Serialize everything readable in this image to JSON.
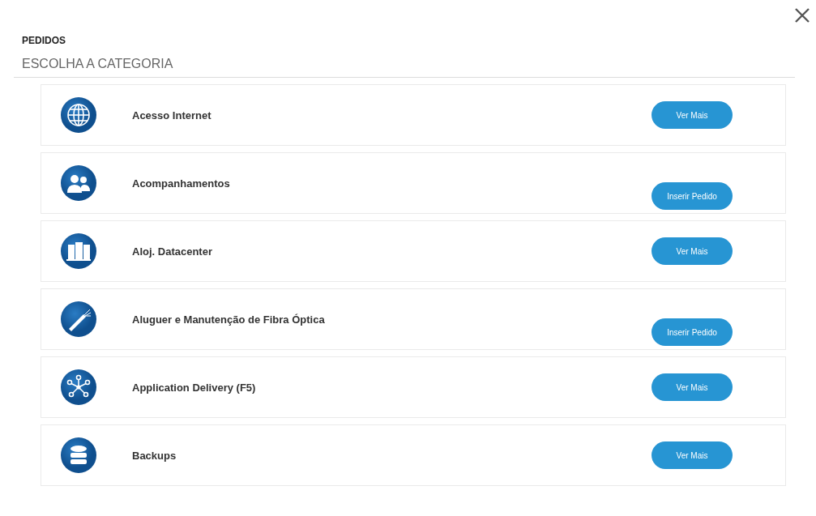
{
  "title": "PEDIDOS",
  "subtitle": "ESCOLHA A CATEGORIA",
  "categories": [
    {
      "name": "Acesso Internet",
      "action": {
        "kind": "more",
        "label": "Ver Mais"
      }
    },
    {
      "name": "Acompanhamentos",
      "action": {
        "kind": "order",
        "label": "Inserir Pedido"
      }
    },
    {
      "name": "Aloj. Datacenter",
      "action": {
        "kind": "more",
        "label": "Ver Mais"
      }
    },
    {
      "name": "Aluguer e Manutenção de Fibra Óptica",
      "action": {
        "kind": "order",
        "label": "Inserir Pedido"
      }
    },
    {
      "name": "Application Delivery (F5)",
      "action": {
        "kind": "more",
        "label": "Ver Mais"
      }
    },
    {
      "name": "Backups",
      "action": {
        "kind": "more",
        "label": "Ver Mais"
      }
    }
  ]
}
